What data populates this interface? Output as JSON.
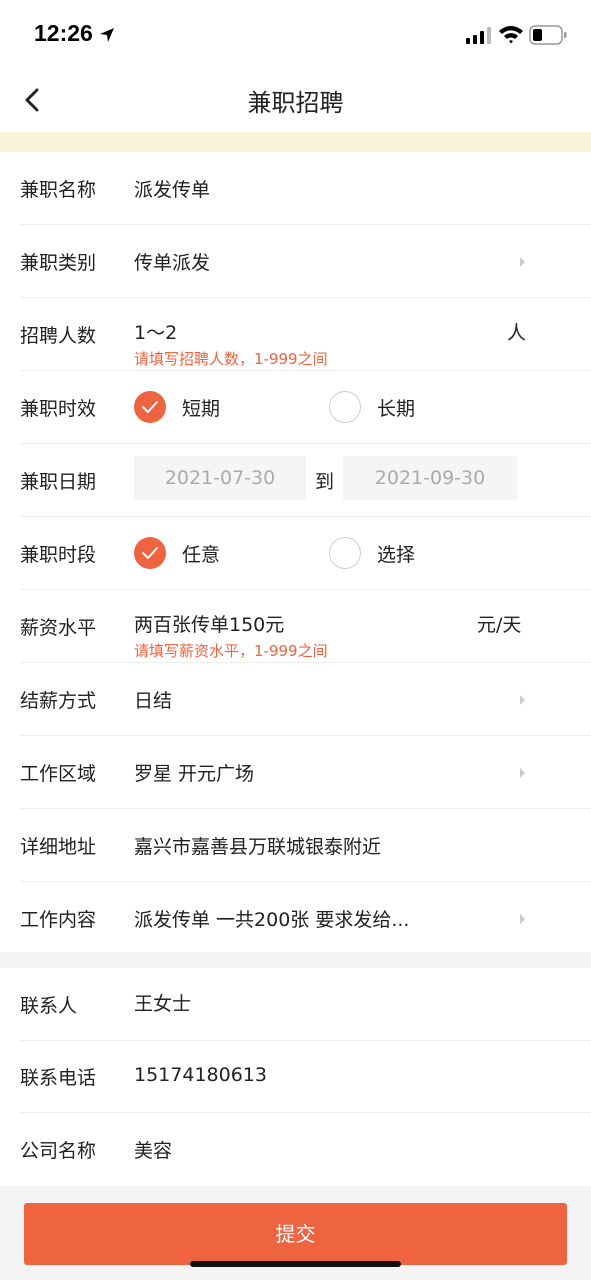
{
  "status_bar": {
    "time": "12:26"
  },
  "header": {
    "title": "兼职招聘"
  },
  "form": {
    "job_name": {
      "label": "兼职名称",
      "value": "派发传单"
    },
    "job_category": {
      "label": "兼职类别",
      "value": "传单派发"
    },
    "headcount": {
      "label": "招聘人数",
      "value": "1～2",
      "unit": "人",
      "hint": "请填写招聘人数，1-999之间"
    },
    "duration": {
      "label": "兼职时效",
      "options": [
        "短期",
        "长期"
      ],
      "selected": "短期"
    },
    "dates": {
      "label": "兼职日期",
      "start": "2021-07-30",
      "to_label": "到",
      "end": "2021-09-30"
    },
    "time_slot": {
      "label": "兼职时段",
      "options": [
        "任意",
        "选择"
      ],
      "selected": "任意"
    },
    "salary": {
      "label": "薪资水平",
      "value": "两百张传单150元",
      "unit": "元/天",
      "hint": "请填写薪资水平，1-999之间"
    },
    "settlement": {
      "label": "结薪方式",
      "value": "日结"
    },
    "work_area": {
      "label": "工作区域",
      "value": "罗星 开元广场"
    },
    "address": {
      "label": "详细地址",
      "value": "嘉兴市嘉善县万联城银泰附近"
    },
    "content": {
      "label": "工作内容",
      "value": "派发传单 一共200张 要求发给..."
    },
    "contact_person": {
      "label": "联系人",
      "value": "王女士"
    },
    "contact_phone": {
      "label": "联系电话",
      "value": "15174180613"
    },
    "company": {
      "label": "公司名称",
      "value": "美容"
    }
  },
  "submit_label": "提交",
  "colors": {
    "accent": "#ee6340",
    "notice": "#fbf2dc",
    "background": "#f4f4f4"
  },
  "icons": [
    "location-arrow-icon",
    "signal-icon",
    "wifi-icon",
    "battery-icon",
    "back-chevron-icon",
    "chevron-right-icon",
    "checkmark-icon"
  ]
}
